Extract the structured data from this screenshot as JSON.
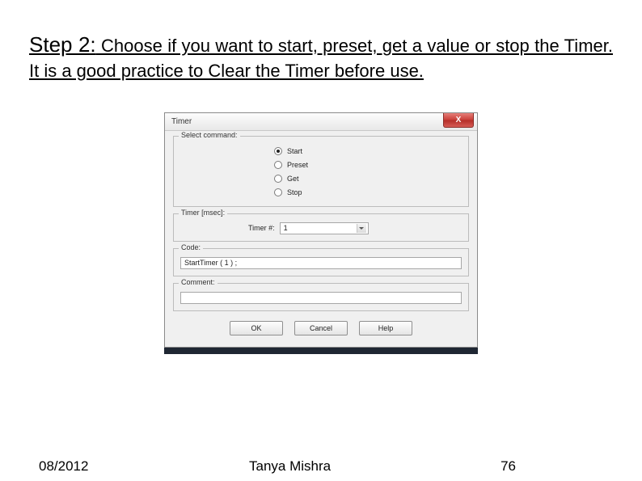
{
  "instruction": {
    "step_label": "Step 2:",
    "text": " Choose if you want to start, preset, get a value or stop the Timer. It is a good practice to Clear the Timer before use."
  },
  "dialog": {
    "title": "Timer",
    "close_glyph": "X",
    "groups": {
      "select_command": {
        "legend": "Select command:",
        "options": [
          {
            "label": "Start",
            "selected": true
          },
          {
            "label": "Preset",
            "selected": false
          },
          {
            "label": "Get",
            "selected": false
          },
          {
            "label": "Stop",
            "selected": false
          }
        ]
      },
      "timer_msec": {
        "legend": "Timer [msec]:",
        "field_label": "Timer #:",
        "value": "1"
      },
      "code": {
        "legend": "Code:",
        "value": "StartTimer ( 1 ) ;"
      },
      "comment": {
        "legend": "Comment:",
        "value": ""
      }
    },
    "buttons": {
      "ok": "OK",
      "cancel": "Cancel",
      "help": "Help"
    }
  },
  "footer": {
    "date": "08/2012",
    "author": "Tanya Mishra",
    "page": "76"
  }
}
